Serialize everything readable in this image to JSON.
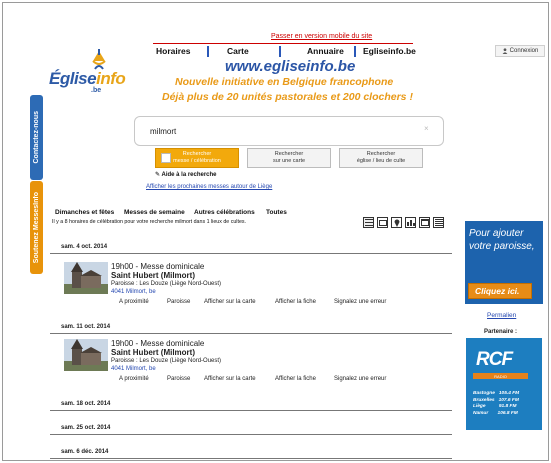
{
  "top_link": "Passer en version mobile du site",
  "nav": {
    "horaires": "Horaires",
    "carte": "Carte",
    "annuaire": "Annuaire",
    "egliseinfo": "Egliseinfo.be"
  },
  "connexion": "Connexion",
  "logo": {
    "eglise": "Église",
    "info": "info",
    "be": ".be"
  },
  "header": {
    "url": "www.egliseinfo.be",
    "tagline1": "Nouvelle initiative en Belgique francophone",
    "tagline2": "Déjà plus de 20 unités pastorales et 200 clochers !"
  },
  "sidetabs": {
    "contact": "Contactez-nous",
    "support": "Soutenez MessesInfo"
  },
  "search": {
    "value": "milmort",
    "clear": "×",
    "btn_mass_l1": "Rechercher",
    "btn_mass_l2": "messe / célébration",
    "btn_map_l1": "Rechercher",
    "btn_map_l2": "sur une carte",
    "btn_church_l1": "Rechercher",
    "btn_church_l2": "église / lieu de culte",
    "help": "Aide à la recherche",
    "nearby": "Afficher les prochaines messes autour de Liège"
  },
  "filters": [
    "Dimanches et fêtes",
    "Messes de semaine",
    "Autres célébrations",
    "Toutes"
  ],
  "result_info": "Il y a 8 horaires de célébration pour votre recherche milmort dans 1 lieux de cultes.",
  "actions": {
    "nearby": "A proximité",
    "parish": "Paroisse",
    "map": "Afficher sur la carte",
    "sheet": "Afficher la fiche",
    "error": "Signalez une erreur"
  },
  "dates": [
    {
      "date": "sam. 4 oct. 2014",
      "mass": {
        "time": "19h00 - Messe dominicale",
        "church": "Saint Hubert (Milmort)",
        "parish": "Paroisse : Les Douze (Liège Nord-Ouest)",
        "address": "4041 Milmort, be"
      }
    },
    {
      "date": "sam. 11 oct. 2014",
      "mass": {
        "time": "19h00 - Messe dominicale",
        "church": "Saint Hubert (Milmort)",
        "parish": "Paroisse : Les Douze (Liège Nord-Ouest)",
        "address": "4041 Milmort, be"
      }
    },
    {
      "date": "sam. 18 oct. 2014"
    },
    {
      "date": "sam. 25 oct. 2014"
    },
    {
      "date": "sam. 6 déc. 2014"
    }
  ],
  "ad": {
    "text": "Pour ajouter votre paroisse,",
    "button": "Cliquez ici."
  },
  "permalien": "Permalien",
  "partenaire": "Partenaire :",
  "rcf": {
    "logo": "RCF",
    "band": "RADIO",
    "freq": "Bastogne   105.4 FM\nBruxelles   107.6 FM\nLiège          91.8 FM\nNamur       106.8 FM"
  },
  "colors": {
    "accent_orange": "#f2a90c",
    "brand_blue": "#2d5aa6",
    "link_blue": "#2447b0",
    "alert_red": "#cc0000"
  }
}
